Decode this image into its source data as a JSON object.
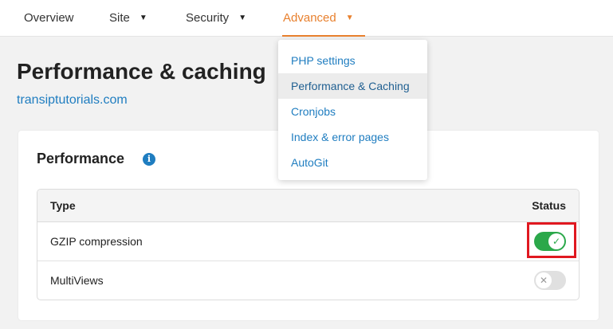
{
  "nav": {
    "items": [
      {
        "label": "Overview",
        "caret": ""
      },
      {
        "label": "Site",
        "caret": "▼"
      },
      {
        "label": "Security",
        "caret": "▼"
      },
      {
        "label": "Advanced",
        "caret": "▼"
      }
    ],
    "active_index": 3
  },
  "header": {
    "title": "Performance & caching",
    "domain": "transiptutorials.com"
  },
  "dropdown": {
    "items": [
      "PHP settings",
      "Performance & Caching",
      "Cronjobs",
      "Index & error pages",
      "AutoGit"
    ],
    "active_index": 1
  },
  "card": {
    "title": "Performance",
    "info_icon": "info-icon",
    "info_glyph": "i"
  },
  "table": {
    "columns": [
      "Type",
      "Status"
    ],
    "rows": [
      {
        "type": "GZIP compression",
        "status": "on",
        "glyph": "✓"
      },
      {
        "type": "MultiViews",
        "status": "off",
        "glyph": "✕"
      }
    ]
  },
  "colors": {
    "accent": "#e8802e",
    "link": "#1f7dc0",
    "toggle_on": "#2ba84a",
    "toggle_off": "#e0e0e0",
    "highlight": "#e01820"
  }
}
